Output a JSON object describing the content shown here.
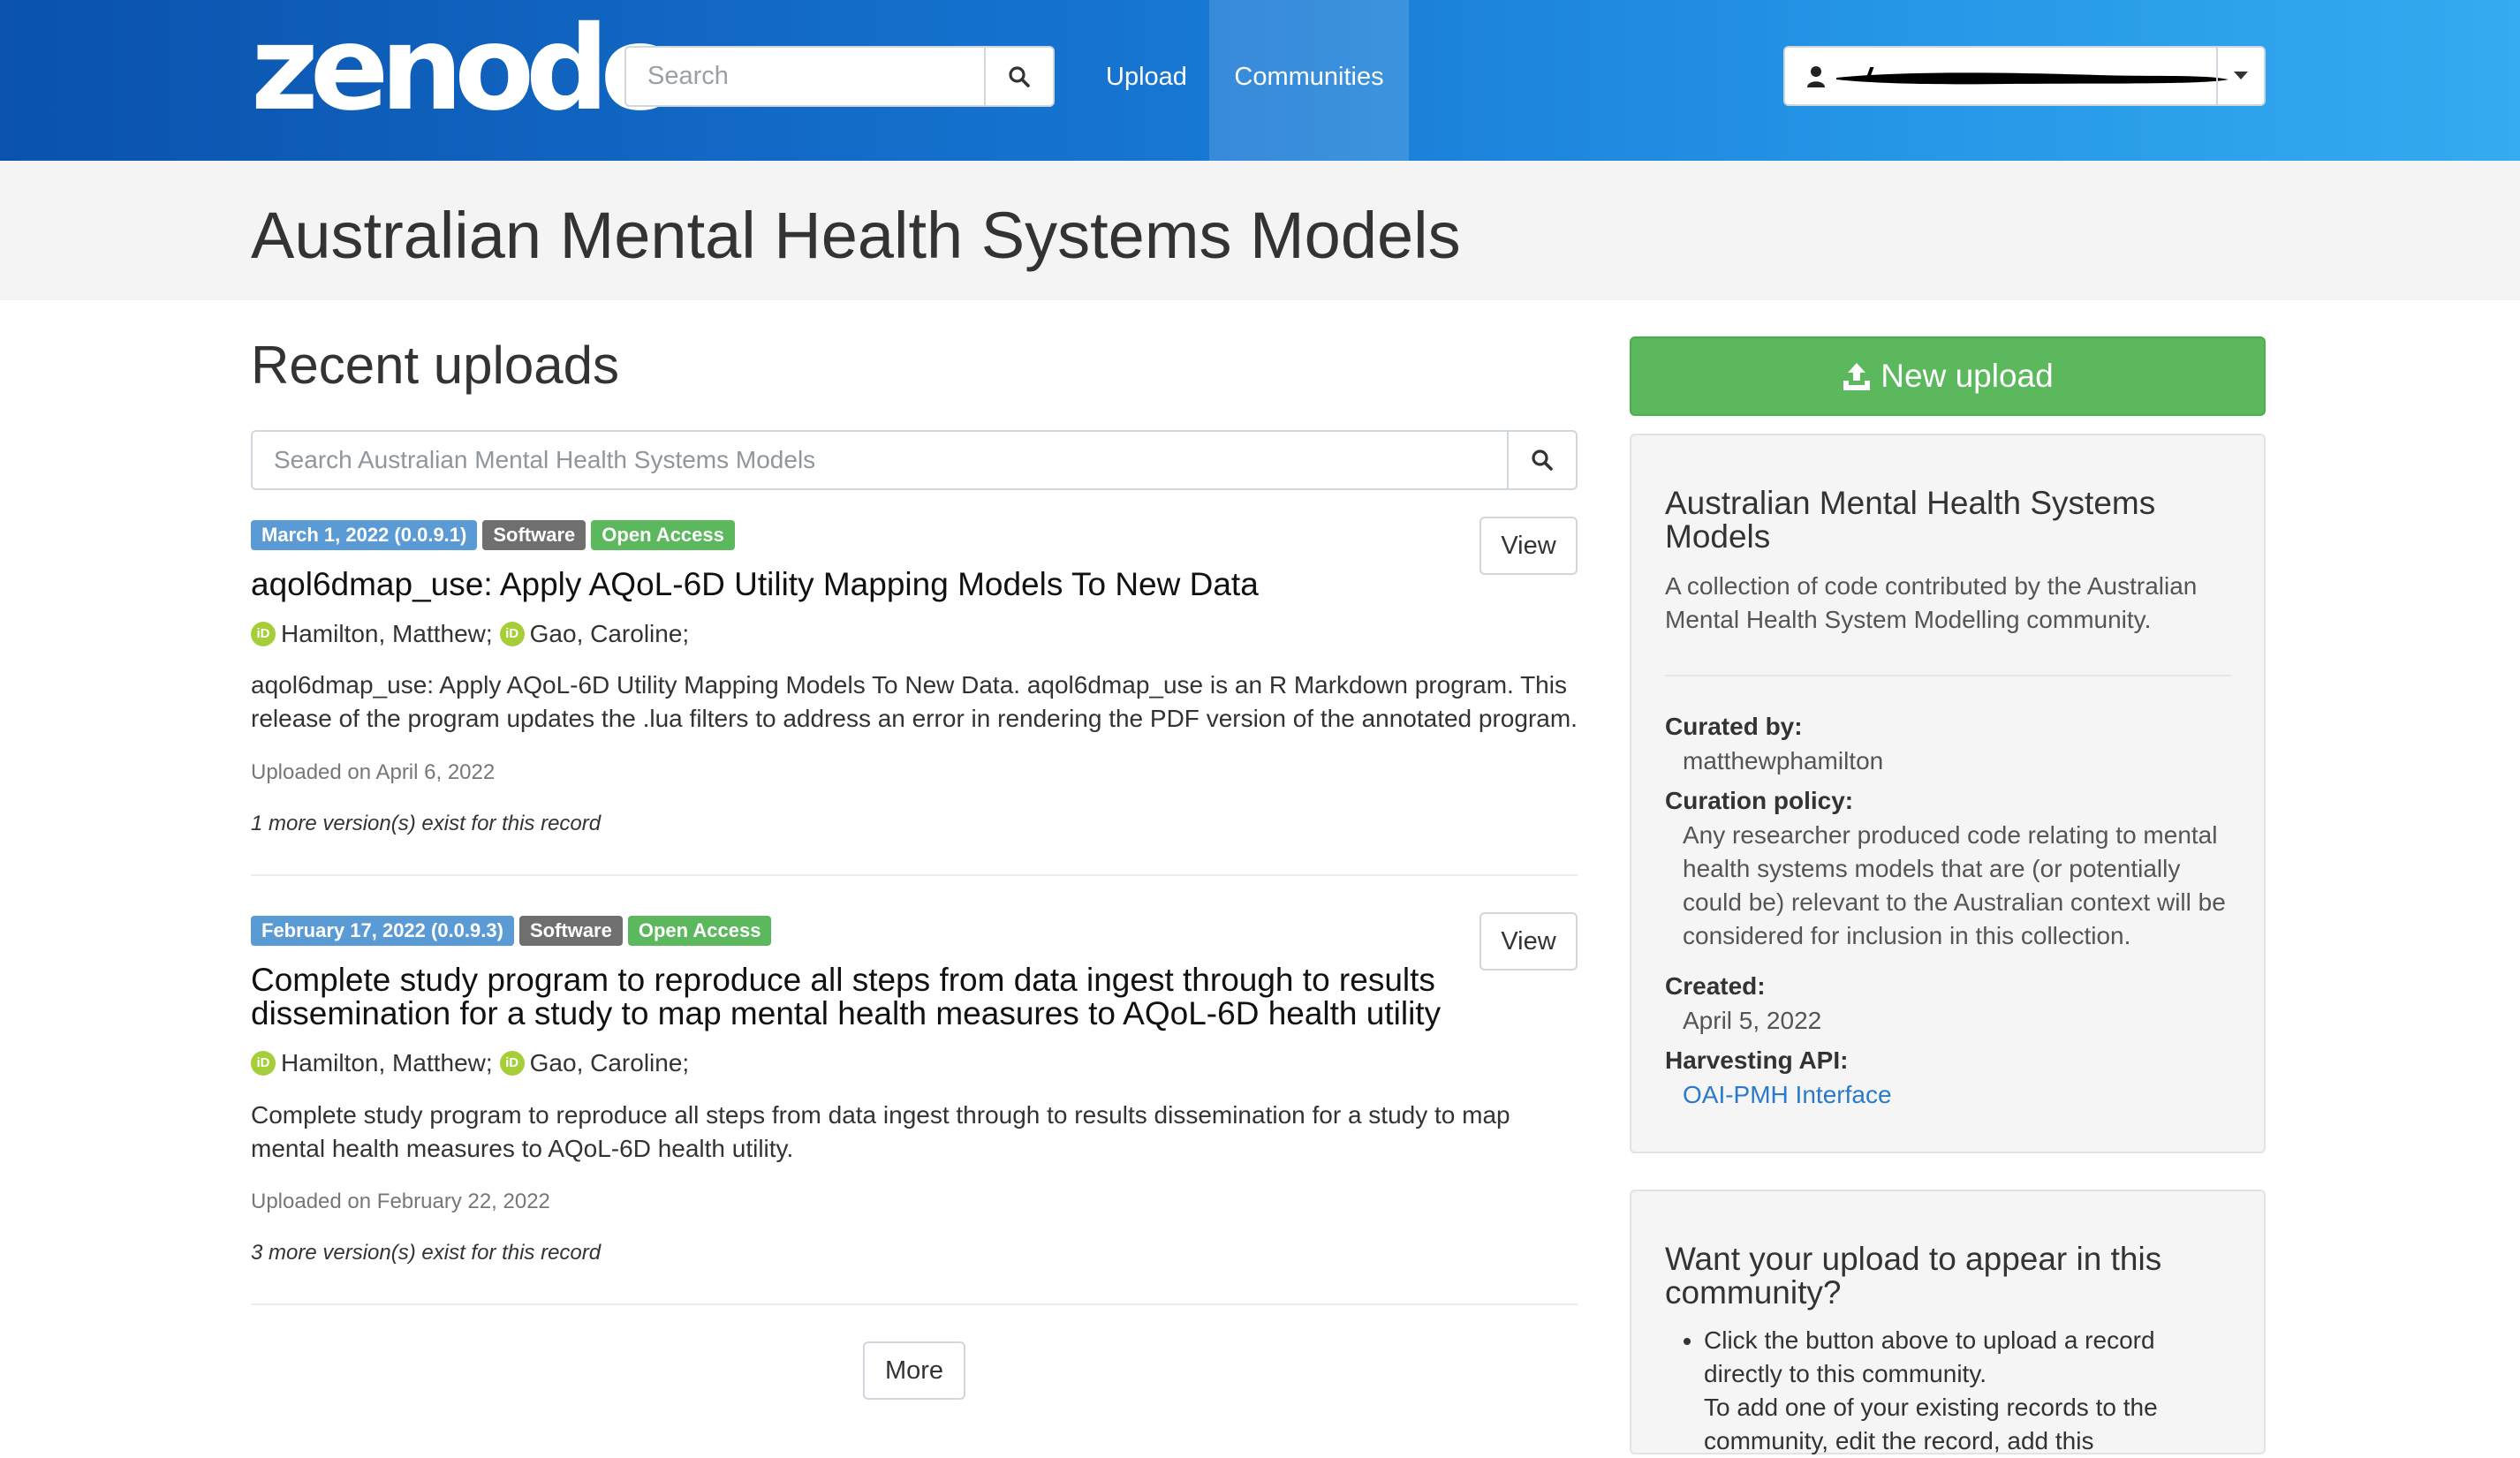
{
  "navbar": {
    "logo": "zenodo",
    "search_placeholder": "Search",
    "links": {
      "upload": "Upload",
      "communities": "Communities"
    },
    "colors": {
      "gradient_start": "#0a52ad",
      "gradient_end": "#35abf1"
    }
  },
  "header": {
    "title": "Australian Mental Health Systems Models"
  },
  "main": {
    "section_title": "Recent uploads",
    "search_placeholder": "Search Australian Mental Health Systems Models",
    "records": [
      {
        "date_badge": "March 1, 2022 (0.0.9.1)",
        "type_badge": "Software",
        "access_badge": "Open Access",
        "view_label": "View",
        "title": "aqol6dmap_use: Apply AQoL-6D Utility Mapping Models To New Data",
        "authors": [
          "Hamilton, Matthew;",
          "Gao, Caroline;"
        ],
        "description": "aqol6dmap_use: Apply AQoL-6D Utility Mapping Models To New Data. aqol6dmap_use is an R Markdown program. This release of the program updates the .lua filters to address an error in rendering the PDF version of the annotated program.",
        "uploaded": "Uploaded on April 6, 2022",
        "versions": "1 more version(s) exist for this record"
      },
      {
        "date_badge": "February 17, 2022 (0.0.9.3)",
        "type_badge": "Software",
        "access_badge": "Open Access",
        "view_label": "View",
        "title": "Complete study program to reproduce all steps from data ingest through to results dissemination for a study to map mental health measures to AQoL-6D health utility",
        "authors": [
          "Hamilton, Matthew;",
          "Gao, Caroline;"
        ],
        "description": "Complete study program to reproduce all steps from data ingest through to results dissemination for a study to map mental health measures to AQoL-6D health utility.",
        "uploaded": "Uploaded on February 22, 2022",
        "versions": "3 more version(s) exist for this record"
      }
    ],
    "more_label": "More"
  },
  "sidebar": {
    "new_upload_label": "New upload",
    "info": {
      "title": "Australian Mental Health Systems Models",
      "description": "A collection of code contributed by the Australian Mental Health System Modelling community.",
      "curated_by_label": "Curated by:",
      "curated_by": "matthewphamilton",
      "policy_label": "Curation policy:",
      "policy": "Any researcher produced code relating to mental health systems models that are (or potentially could be) relevant to the Australian context will be considered for inclusion in this collection.",
      "created_label": "Created:",
      "created": "April 5, 2022",
      "api_label": "Harvesting API:",
      "api_link": "OAI-PMH Interface"
    },
    "want": {
      "title": "Want your upload to appear in this community?",
      "item_1": "Click the button above to upload a record directly to this community.",
      "item_2": "To add one of your existing records to the community, edit the record, add this"
    }
  },
  "colors": {
    "green": "#5cb85c",
    "badge_blue": "#5b9bd5",
    "badge_gray": "#6f6f6f",
    "link": "#2a7ac9",
    "orcid": "#a6ce39"
  }
}
